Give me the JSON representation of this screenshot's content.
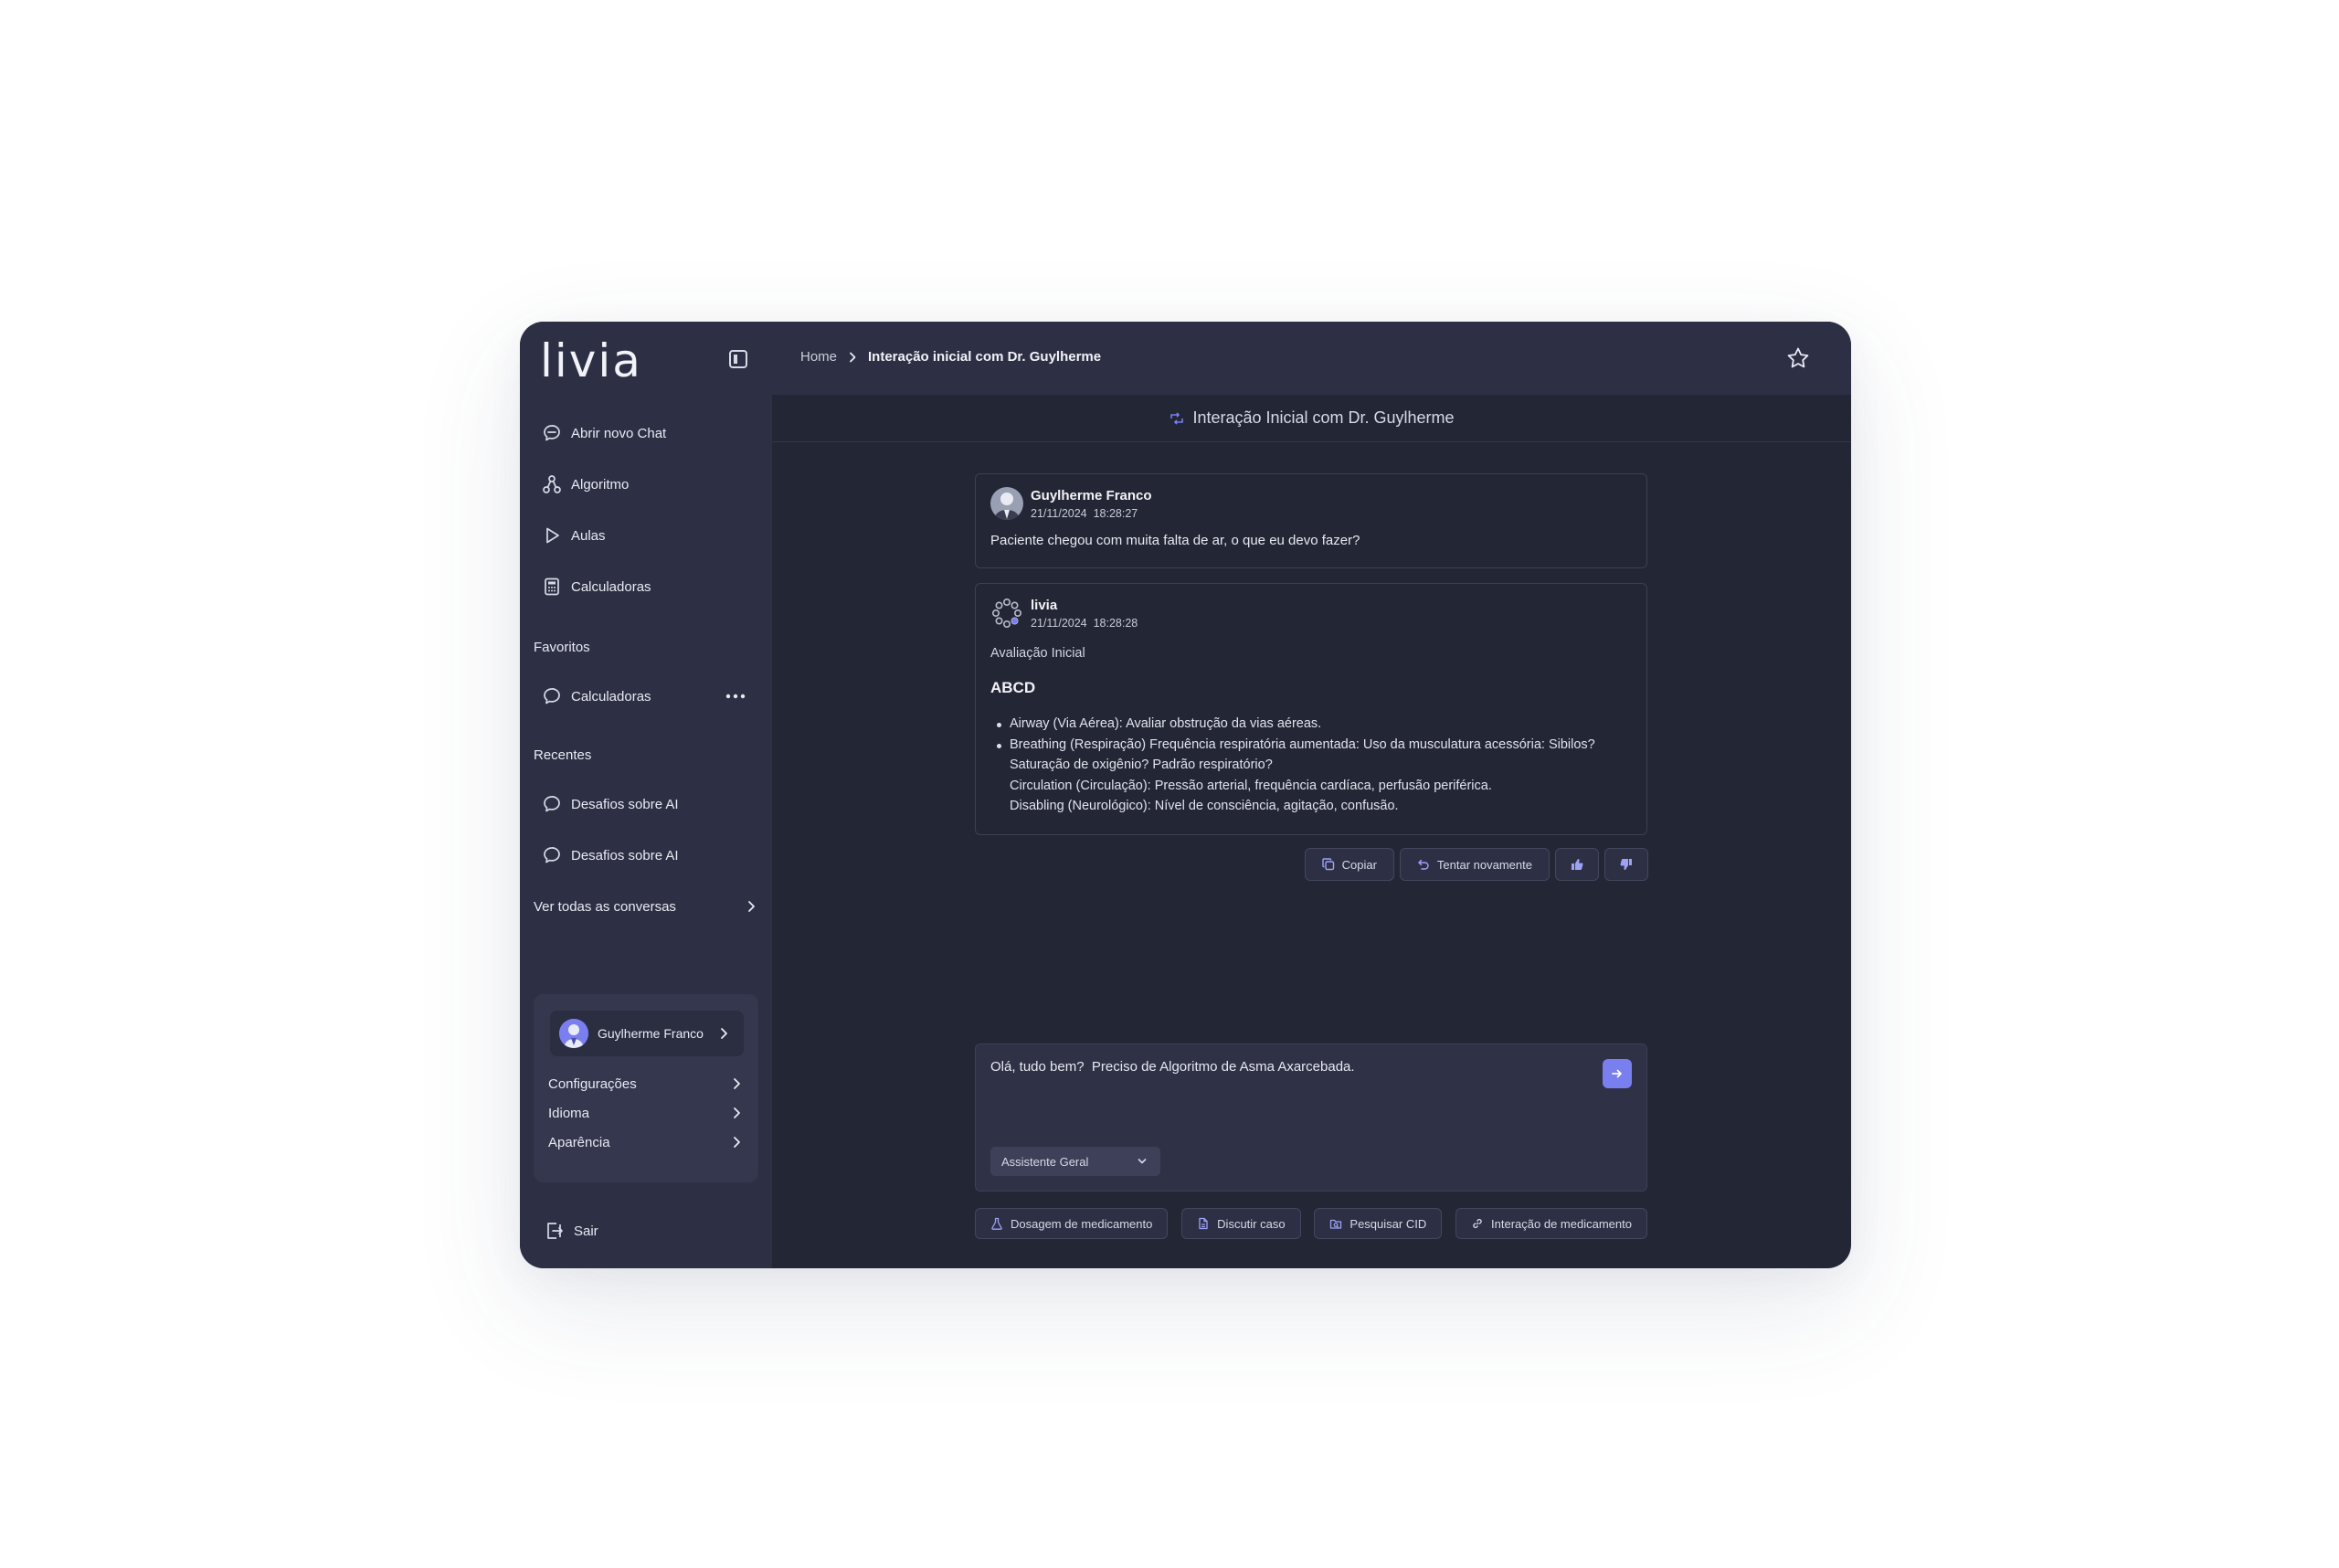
{
  "brand": {
    "logo": "livia"
  },
  "sidebar": {
    "nav": [
      {
        "label": "Abrir novo Chat",
        "icon": "chat-plus-icon"
      },
      {
        "label": "Algoritmo",
        "icon": "algorithm-icon"
      },
      {
        "label": "Aulas",
        "icon": "play-icon"
      },
      {
        "label": "Calculadoras",
        "icon": "calculator-icon"
      }
    ],
    "favorites_label": "Favoritos",
    "favorites": [
      {
        "label": "Calculadoras",
        "icon": "chat-bubble-icon"
      }
    ],
    "recents_label": "Recentes",
    "recents": [
      {
        "label": "Desafios sobre AI",
        "icon": "chat-bubble-icon"
      },
      {
        "label": "Desafios sobre AI",
        "icon": "chat-bubble-icon"
      }
    ],
    "see_all": "Ver todas as conversas",
    "user": {
      "name": "Guylherme Franco"
    },
    "settings": [
      {
        "label": "Configurações"
      },
      {
        "label": "Idioma"
      },
      {
        "label": "Aparência"
      }
    ],
    "logout": "Sair"
  },
  "header": {
    "breadcrumb_home": "Home",
    "breadcrumb_current": "Interação inicial com Dr. Guylherme",
    "chat_title": "Interação Inicial com Dr. Guylherme"
  },
  "messages": {
    "user": {
      "name": "Guylherme Franco",
      "date": "21/11/2024",
      "time": "18:28:27",
      "text": "Paciente chegou com muita falta de ar, o que eu devo fazer?"
    },
    "ai": {
      "name": "livia",
      "date": "21/11/2024",
      "time": "18:28:28",
      "subtitle": "Avaliação Inicial",
      "heading": "ABCD",
      "items": [
        {
          "bullet": true,
          "text": "Airway (Via Aérea): Avaliar obstrução da vias aéreas."
        },
        {
          "bullet": true,
          "text": "Breathing (Respiração) Frequência respiratória aumentada: Uso da musculatura acessória: Sibilos?"
        },
        {
          "bullet": false,
          "text": "Saturação de oxigênio? Padrão respiratório?"
        },
        {
          "bullet": false,
          "text": "Circulation (Circulação): Pressão arterial, frequência cardíaca, perfusão periférica."
        },
        {
          "bullet": false,
          "text": "Disabling (Neurológico): Nível de consciência, agitação, confusão."
        }
      ]
    }
  },
  "actions": {
    "copy": "Copiar",
    "retry": "Tentar novamente"
  },
  "composer": {
    "value": "Olá, tudo bem?  Preciso de Algoritmo de Asma Axarcebada.",
    "assistant": "Assistente Geral"
  },
  "quick_actions": [
    {
      "label": "Dosagem de medicamento",
      "icon": "flask-icon"
    },
    {
      "label": "Discutir caso",
      "icon": "document-icon"
    },
    {
      "label": "Pesquisar CID",
      "icon": "folder-search-icon"
    },
    {
      "label": "Interação de medicamento",
      "icon": "link-icon"
    }
  ],
  "colors": {
    "accent": "#7a7ff0",
    "sidebar_bg": "#2d3044",
    "main_bg": "#232634"
  }
}
